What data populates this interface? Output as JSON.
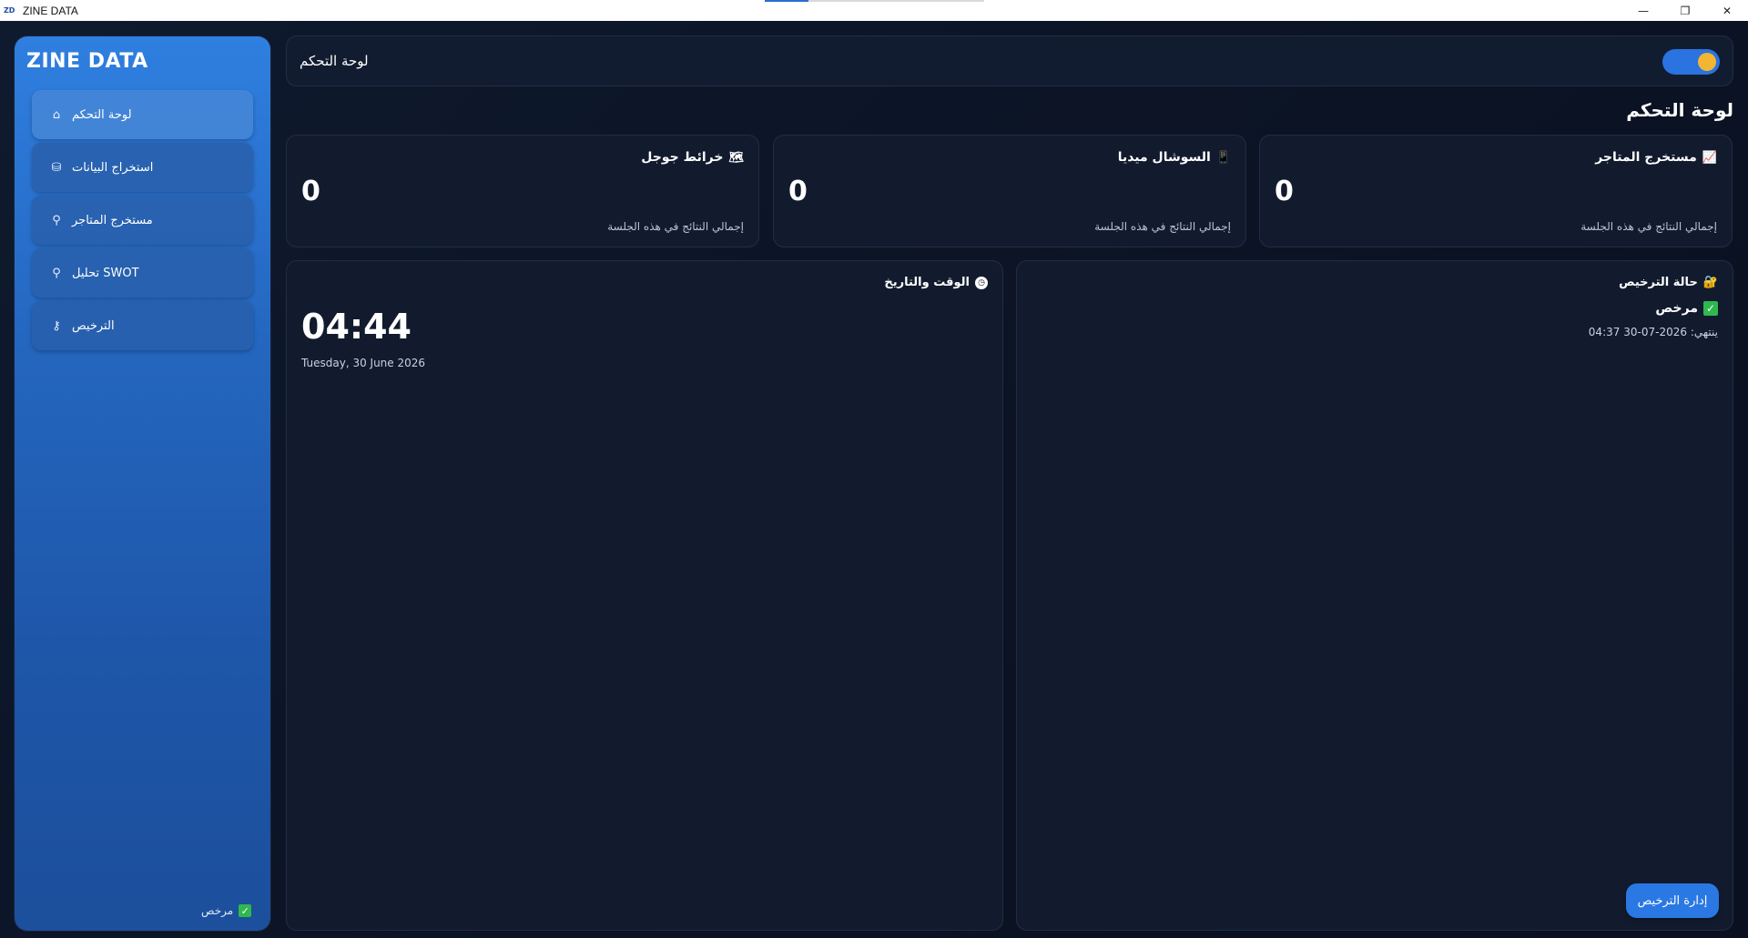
{
  "window": {
    "logo": "ZD",
    "title": "ZINE DATA",
    "controls": {
      "minimize": "—",
      "maximize": "❐",
      "close": "✕"
    }
  },
  "sidebar": {
    "brand": "ZINE DATA",
    "items": [
      {
        "label": "لوحة التحكم",
        "icon": "home-icon",
        "glyph": "⌂",
        "active": true
      },
      {
        "label": "استخراج البيانات",
        "icon": "database-icon",
        "glyph": "⛁",
        "active": false
      },
      {
        "label": "مستخرج المتاجر",
        "icon": "search-icon",
        "glyph": "⚲",
        "active": false
      },
      {
        "label": "تحليل SWOT",
        "icon": "search-icon",
        "glyph": "⚲",
        "active": false
      },
      {
        "label": "الترخيص",
        "icon": "key-icon",
        "glyph": "⚷",
        "active": false
      }
    ],
    "footer_status": "مرخص"
  },
  "topbar": {
    "title": "لوحة التحكم",
    "theme_toggle_on": true
  },
  "page": {
    "heading": "لوحة التحكم"
  },
  "stats": [
    {
      "title": "مستخرج المتاجر",
      "icon": "chart-icon",
      "value": "0",
      "subtitle": "إجمالي النتائج في هذه الجلسة"
    },
    {
      "title": "السوشال ميديا",
      "icon": "phone-icon",
      "value": "0",
      "subtitle": "إجمالي النتائج في هذه الجلسة"
    },
    {
      "title": "خرائط جوجل",
      "icon": "map-icon",
      "value": "0",
      "subtitle": "إجمالي النتائج في هذه الجلسة"
    }
  ],
  "license_panel": {
    "title": "حالة الترخيص",
    "status": "مرخص",
    "expiry": "ينتهي: 2026-07-30 04:37",
    "manage_button": "إدارة الترخيص"
  },
  "time_panel": {
    "title": "الوقت والتاريخ",
    "time": "04:44",
    "date": "Tuesday, 30 June 2026"
  },
  "colors": {
    "accent": "#2a78e4",
    "success": "#2fb84f",
    "toggle_knob": "#f2b632",
    "background": "#0d1424"
  }
}
